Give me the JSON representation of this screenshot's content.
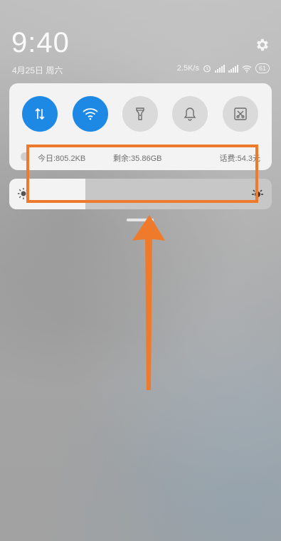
{
  "status": {
    "time": "9:40",
    "date": "4月25日 周六",
    "net_speed": "2.5K/s",
    "battery": "61",
    "icons": [
      "settings-gear-icon",
      "alarm-clock-icon",
      "signal-1-icon",
      "signal-2-icon",
      "wifi-icon",
      "battery-icon"
    ]
  },
  "quick_settings": {
    "toggles": [
      {
        "name": "mobile-data",
        "icon": "data-arrows-icon",
        "state": "on"
      },
      {
        "name": "wifi",
        "icon": "wifi-icon",
        "state": "on"
      },
      {
        "name": "flashlight",
        "icon": "flashlight-icon",
        "state": "off"
      },
      {
        "name": "notifications",
        "icon": "bell-icon",
        "state": "off"
      },
      {
        "name": "screenshot",
        "icon": "screenshot-icon",
        "state": "off"
      }
    ],
    "data_usage": {
      "today": "今日:805.2KB",
      "remaining": "剩余:35.86GB",
      "fee": "话费:54.3元"
    }
  },
  "brightness": {
    "level": 0.29
  },
  "colors": {
    "accent": "#1e88e5",
    "annotation": "#f07a2c",
    "card_bg": "#f3f3f3"
  }
}
